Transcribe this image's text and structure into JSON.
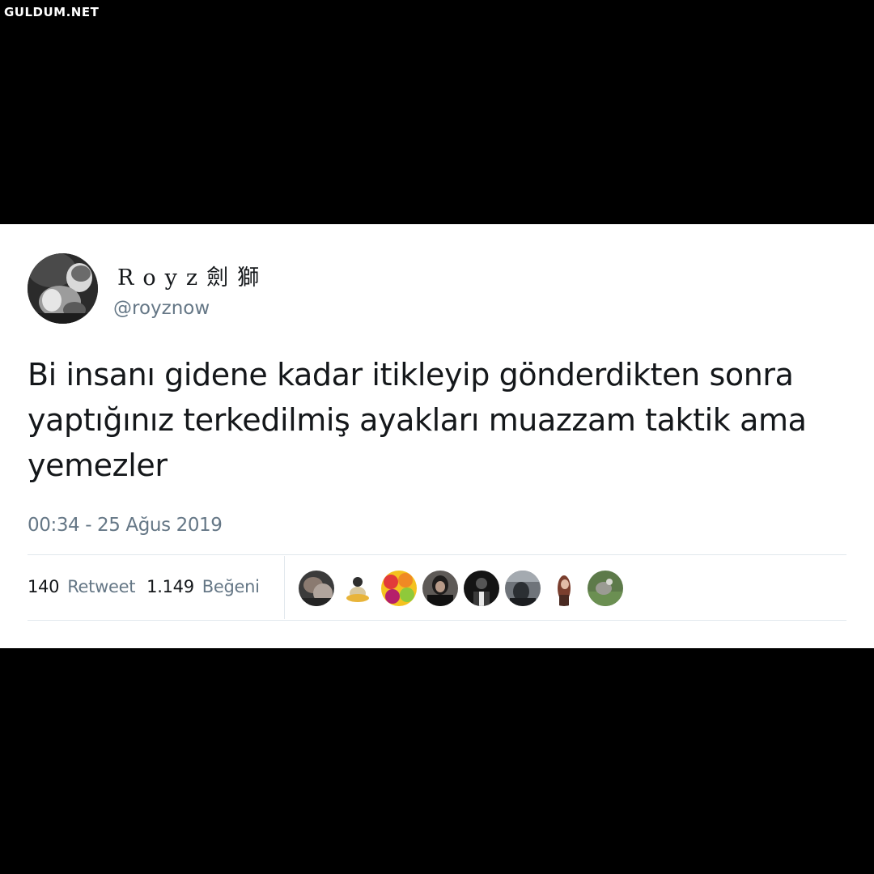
{
  "watermark": "GULDUM.NET",
  "tweet": {
    "display_name": "Royz劍獅",
    "handle": "@royznow",
    "text": "Bi insanı gidene kadar itikleyip gönderdikten sonra yaptığınız terkedilmiş ayakları muazzam taktik ama yemezler",
    "timestamp": "00:34 - 25 Ağus 2019",
    "retweets": {
      "count": "140",
      "label": "Retweet"
    },
    "likes": {
      "count": "1.149",
      "label": "Beğeni"
    }
  },
  "colors": {
    "background": "#000000",
    "card": "#ffffff",
    "text_primary": "#14171a",
    "text_secondary": "#657786",
    "divider": "#e1e8ed"
  },
  "liker_avatars": [
    "liker-avatar-1",
    "liker-avatar-2",
    "liker-avatar-3",
    "liker-avatar-4",
    "liker-avatar-5",
    "liker-avatar-6",
    "liker-avatar-7",
    "liker-avatar-8"
  ]
}
